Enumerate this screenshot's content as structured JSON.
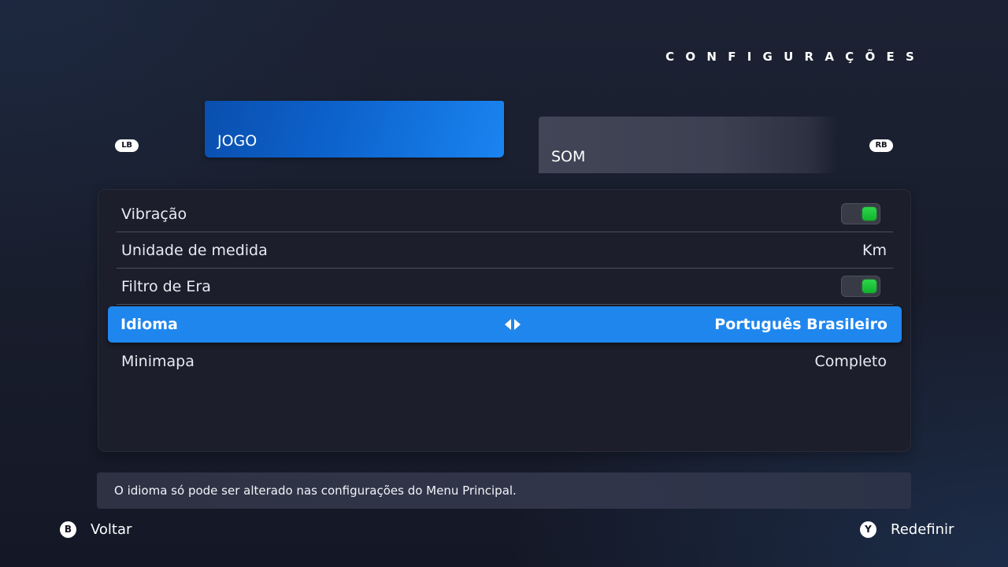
{
  "header": {
    "title": "CONFIGURAÇÕES"
  },
  "tabs": {
    "left_bumper": "LB",
    "right_bumper": "RB",
    "items": [
      {
        "label": "JOGO",
        "active": true
      },
      {
        "label": "SOM",
        "active": false
      }
    ]
  },
  "settings": [
    {
      "label": "Vibração",
      "type": "toggle",
      "value": "on"
    },
    {
      "label": "Unidade de medida",
      "type": "value",
      "value": "Km"
    },
    {
      "label": "Filtro de Era",
      "type": "toggle",
      "value": "on"
    },
    {
      "label": "Idioma",
      "type": "selector",
      "value": "Português Brasileiro",
      "selected": true
    },
    {
      "label": "Minimapa",
      "type": "value",
      "value": "Completo"
    }
  ],
  "hint": "O idioma só pode ser alterado nas configurações do Menu Principal.",
  "footer": {
    "back": {
      "button": "B",
      "label": "Voltar"
    },
    "reset": {
      "button": "Y",
      "label": "Redefinir"
    }
  },
  "colors": {
    "accent": "#1f86ee",
    "toggle_on": "#1dc23a",
    "panel": "#1c1e2b"
  }
}
